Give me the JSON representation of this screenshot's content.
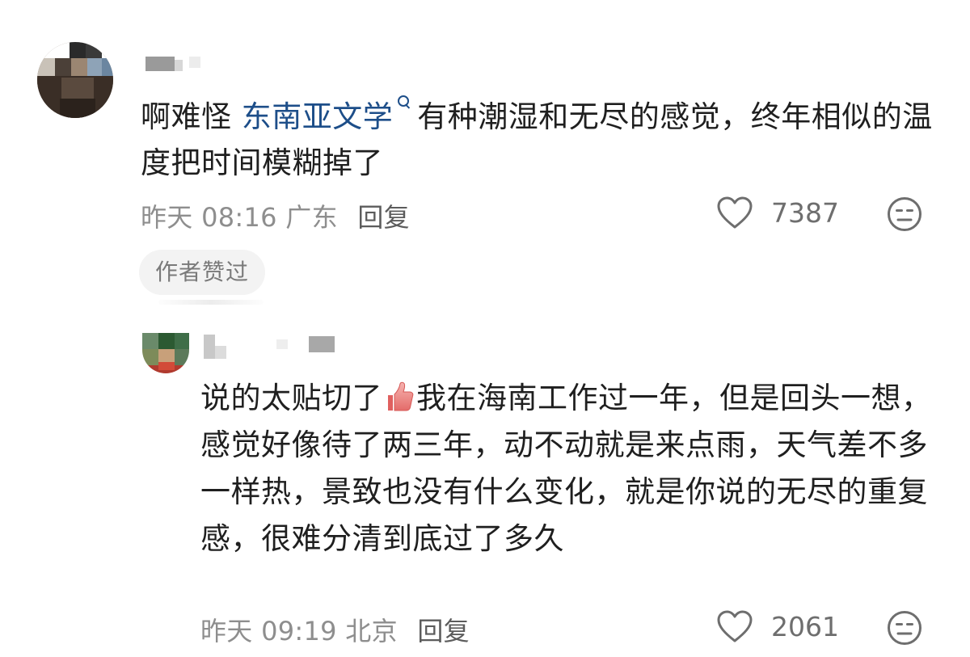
{
  "comments": [
    {
      "username": "",
      "text_prefix": "啊难怪 ",
      "topic_link": "东南亚文学",
      "text_suffix": "有种潮湿和无尽的感觉，终年相似的温度把时间模糊掉了",
      "time": "昨天 08:16",
      "location": "广东",
      "reply_label": "回复",
      "likes": "7387",
      "badge": "作者赞过"
    },
    {
      "username": "",
      "text_before_emoji": "说的太贴切了",
      "emoji": "thumbs-up-emoji",
      "text_after_emoji": "我在海南工作过一年，但是回头一想，感觉好像待了两三年，动不动就是来点雨，天气差不多一样热，景致也没有什么变化，就是你说的无尽的重复感，很难分清到底过了多久",
      "time": "昨天 09:19",
      "location": "北京",
      "reply_label": "回复",
      "likes": "2061"
    }
  ],
  "icons": {
    "like": "heart-outline-icon",
    "dislike": "meh-face-icon",
    "topic_search": "search-icon"
  },
  "colors": {
    "link": "#1d4e89",
    "meta": "#8e8e8e",
    "text": "#1f1f1f"
  }
}
